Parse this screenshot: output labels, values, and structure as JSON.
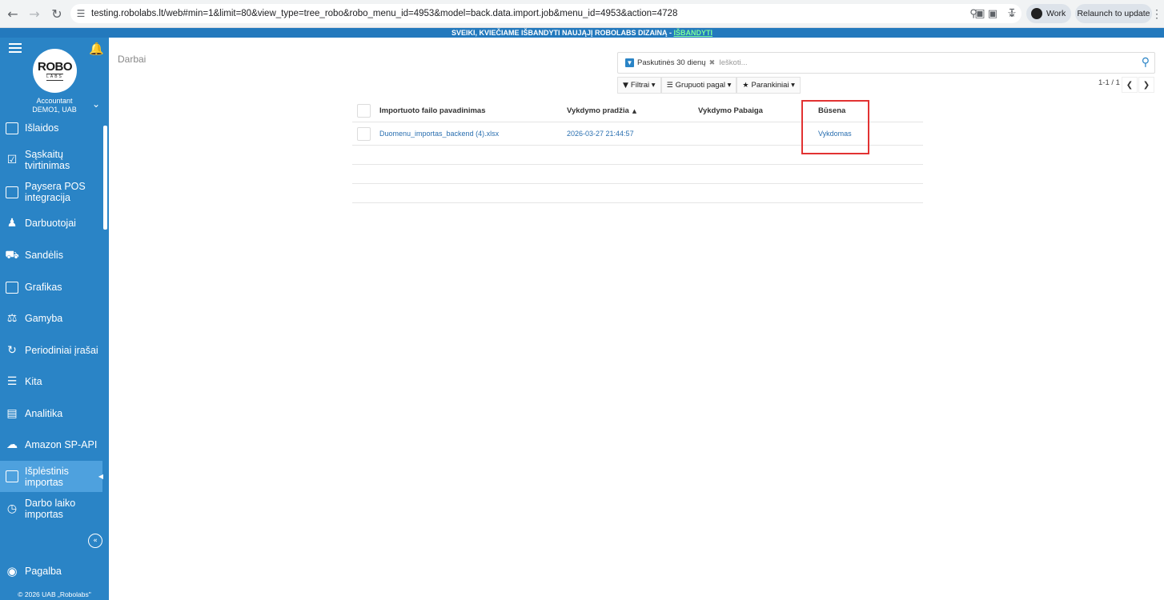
{
  "browser": {
    "url": "testing.robolabs.lt/web#min=1&limit=80&view_type=tree_robo&robo_menu_id=4953&model=back.data.import.job&menu_id=4953&action=4728",
    "profile_label": "Work",
    "relaunch_label": "Relaunch to update"
  },
  "banner": {
    "text": "SVEIKI, KVIEČIAME IŠBANDYTI NAUJĄJĮ ROBOLABS DIZAINĄ - ",
    "link": "IŠBANDYTI"
  },
  "sidebar": {
    "logo_top": "ROBO",
    "logo_bottom": "LABS",
    "account_role": "Accountant",
    "account_company": "DEMO1, UAB",
    "items": [
      {
        "label": "Išlaidos",
        "icon": "receipt-icon"
      },
      {
        "label": "Sąskaitų tvirtinimas",
        "icon": "invoice-approve-icon"
      },
      {
        "label": "Paysera POS integracija",
        "icon": "payment-terminal-icon"
      },
      {
        "label": "Darbuotojai",
        "icon": "employee-icon"
      },
      {
        "label": "Sandėlis",
        "icon": "truck-icon"
      },
      {
        "label": "Grafikas",
        "icon": "schedule-icon"
      },
      {
        "label": "Gamyba",
        "icon": "factory-icon"
      },
      {
        "label": "Periodiniai įrašai",
        "icon": "refresh-icon"
      },
      {
        "label": "Kita",
        "icon": "list-icon"
      },
      {
        "label": "Analitika",
        "icon": "analytics-icon"
      },
      {
        "label": "Amazon SP-API",
        "icon": "cloud-icon"
      },
      {
        "label": "Išplėstinis importas",
        "icon": "import-file-icon"
      },
      {
        "label": "Darbo laiko importas",
        "icon": "clock-icon"
      }
    ],
    "help_label": "Pagalba",
    "copyright": "© 2026 UAB „Robolabs\""
  },
  "main": {
    "breadcrumb": "Darbai",
    "search": {
      "facet_label": "Paskutinės 30 dienų",
      "placeholder": "Ieškoti..."
    },
    "buttons": {
      "filters": "Filtrai",
      "group_by": "Grupuoti pagal",
      "favorites": "Parankiniai"
    },
    "pager": "1-1 / 1",
    "table": {
      "columns": [
        "Importuoto failo pavadinimas",
        "Vykdymo pradžia",
        "Vykdymo Pabaiga",
        "Būsena"
      ],
      "rows": [
        {
          "file": "Duomenu_importas_backend (4).xlsx",
          "start": "2026-03-27 21:44:57",
          "end": "",
          "status": "Vykdomas"
        }
      ]
    }
  },
  "colors": {
    "sidebar": "#2a84c6",
    "sidebar_active": "#4ea1de",
    "highlight": "#e23232",
    "link": "#2a6fb0"
  }
}
